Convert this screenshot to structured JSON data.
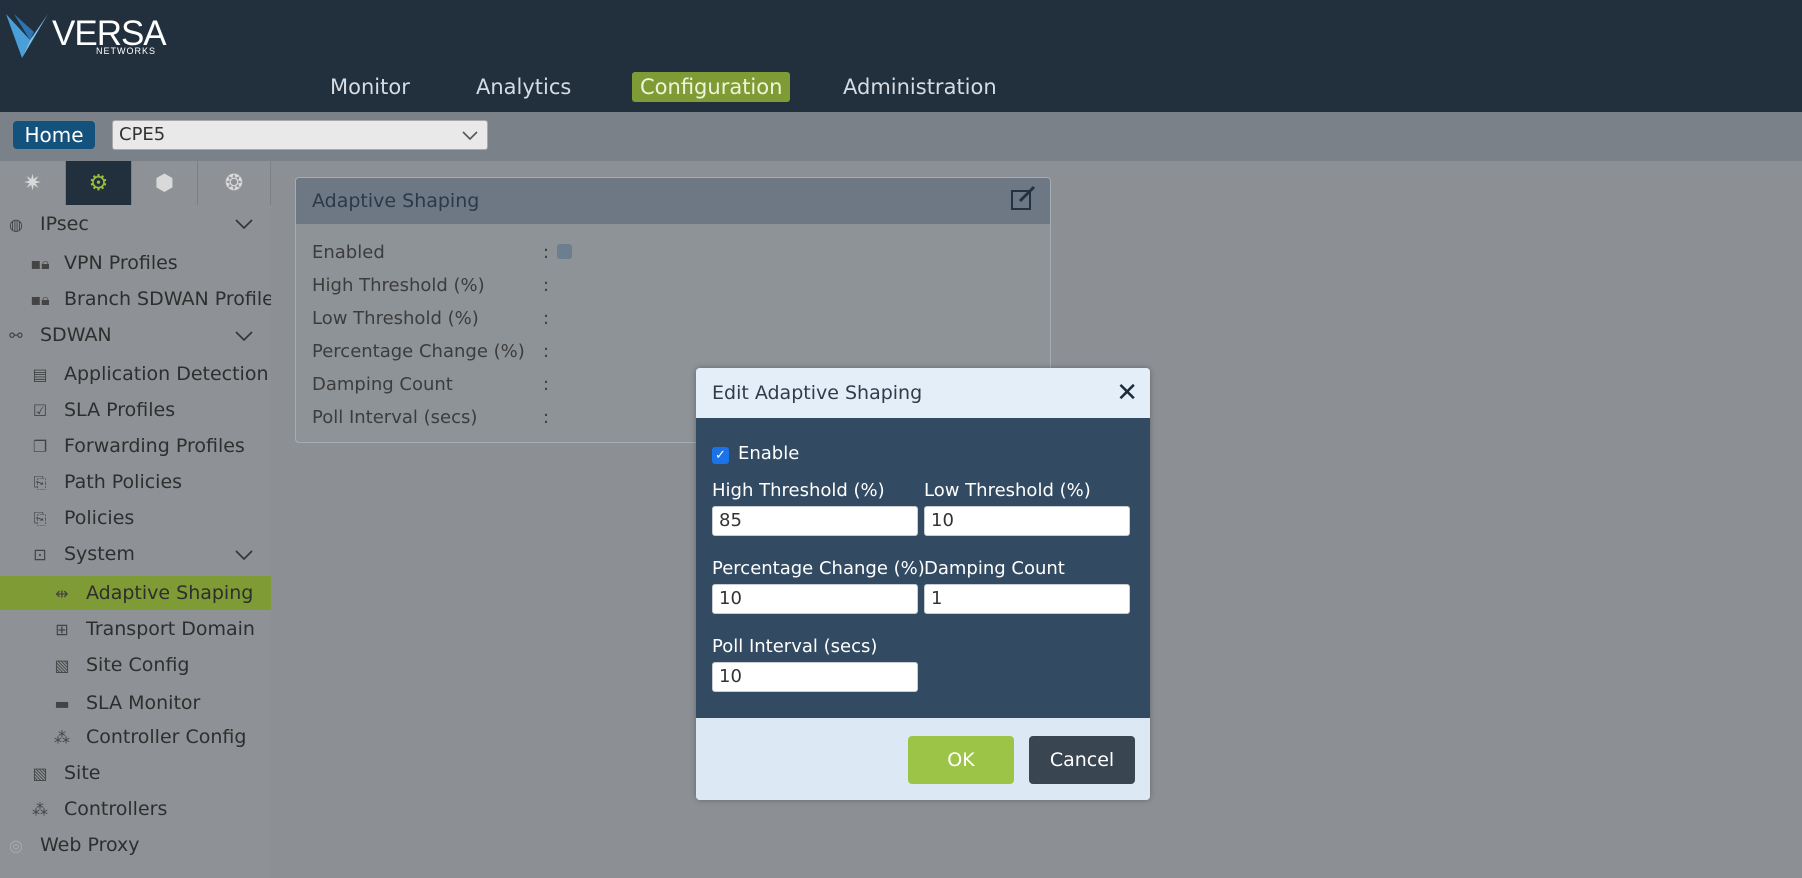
{
  "brand": {
    "name": "VERSA",
    "sub": "NETWORKS"
  },
  "nav": {
    "tabs": [
      {
        "label": "Monitor"
      },
      {
        "label": "Analytics"
      },
      {
        "label": "Configuration",
        "active": true
      },
      {
        "label": "Administration"
      }
    ]
  },
  "subbar": {
    "home_label": "Home",
    "device": "CPE5"
  },
  "sidebar": {
    "tabs": [
      "network-icon",
      "gear-icon",
      "cube-icon",
      "globe-gear-icon"
    ],
    "items": [
      {
        "label": "IPsec",
        "icon": "ipsec-icon",
        "expanded": true
      },
      {
        "label": "VPN Profiles",
        "icon": "lock-icon"
      },
      {
        "label": "Branch SDWAN Profile",
        "icon": "lock-icon"
      },
      {
        "label": "SDWAN",
        "icon": "sdwan-icon",
        "expanded": true
      },
      {
        "label": "Application Detection",
        "icon": "document-icon"
      },
      {
        "label": "SLA Profiles",
        "icon": "checklist-icon"
      },
      {
        "label": "Forwarding Profiles",
        "icon": "stack-icon"
      },
      {
        "label": "Path Policies",
        "icon": "policy-icon"
      },
      {
        "label": "Policies",
        "icon": "policy-icon"
      },
      {
        "label": "System",
        "icon": "computer-icon",
        "expanded": true
      },
      {
        "label": "Adaptive Shaping",
        "icon": "shaping-icon",
        "selected": true
      },
      {
        "label": "Transport Domain",
        "icon": "hierarchy-icon"
      },
      {
        "label": "Site Config",
        "icon": "site-config-icon"
      },
      {
        "label": "SLA Monitor",
        "icon": "monitor-icon"
      },
      {
        "label": "Controller Config",
        "icon": "controllers-icon"
      },
      {
        "label": "Site",
        "icon": "site-icon"
      },
      {
        "label": "Controllers",
        "icon": "controllers-icon"
      },
      {
        "label": "Web Proxy",
        "icon": "globe-icon"
      }
    ]
  },
  "panel": {
    "title": "Adaptive Shaping",
    "rows": [
      {
        "label": "Enabled",
        "value": ""
      },
      {
        "label": "High Threshold (%)",
        "value": ""
      },
      {
        "label": "Low Threshold (%)",
        "value": ""
      },
      {
        "label": "Percentage Change (%)",
        "value": ""
      },
      {
        "label": "Damping Count",
        "value": ""
      },
      {
        "label": "Poll Interval (secs)",
        "value": ""
      }
    ]
  },
  "dialog": {
    "title": "Edit Adaptive Shaping",
    "enable_label": "Enable",
    "enable_checked": true,
    "high_threshold_label": "High Threshold (%)",
    "high_threshold_value": "85",
    "low_threshold_label": "Low Threshold (%)",
    "low_threshold_value": "10",
    "percentage_change_label": "Percentage Change (%)",
    "percentage_change_value": "10",
    "damping_count_label": "Damping Count",
    "damping_count_value": "1",
    "poll_interval_label": "Poll Interval (secs)",
    "poll_interval_value": "10",
    "ok_label": "OK",
    "cancel_label": "Cancel"
  },
  "colors": {
    "topbar": "#22303e",
    "accent_green": "#7f9b35",
    "ok_button": "#9cc447",
    "dialog_body": "#334b62",
    "home_button": "#14527e"
  }
}
